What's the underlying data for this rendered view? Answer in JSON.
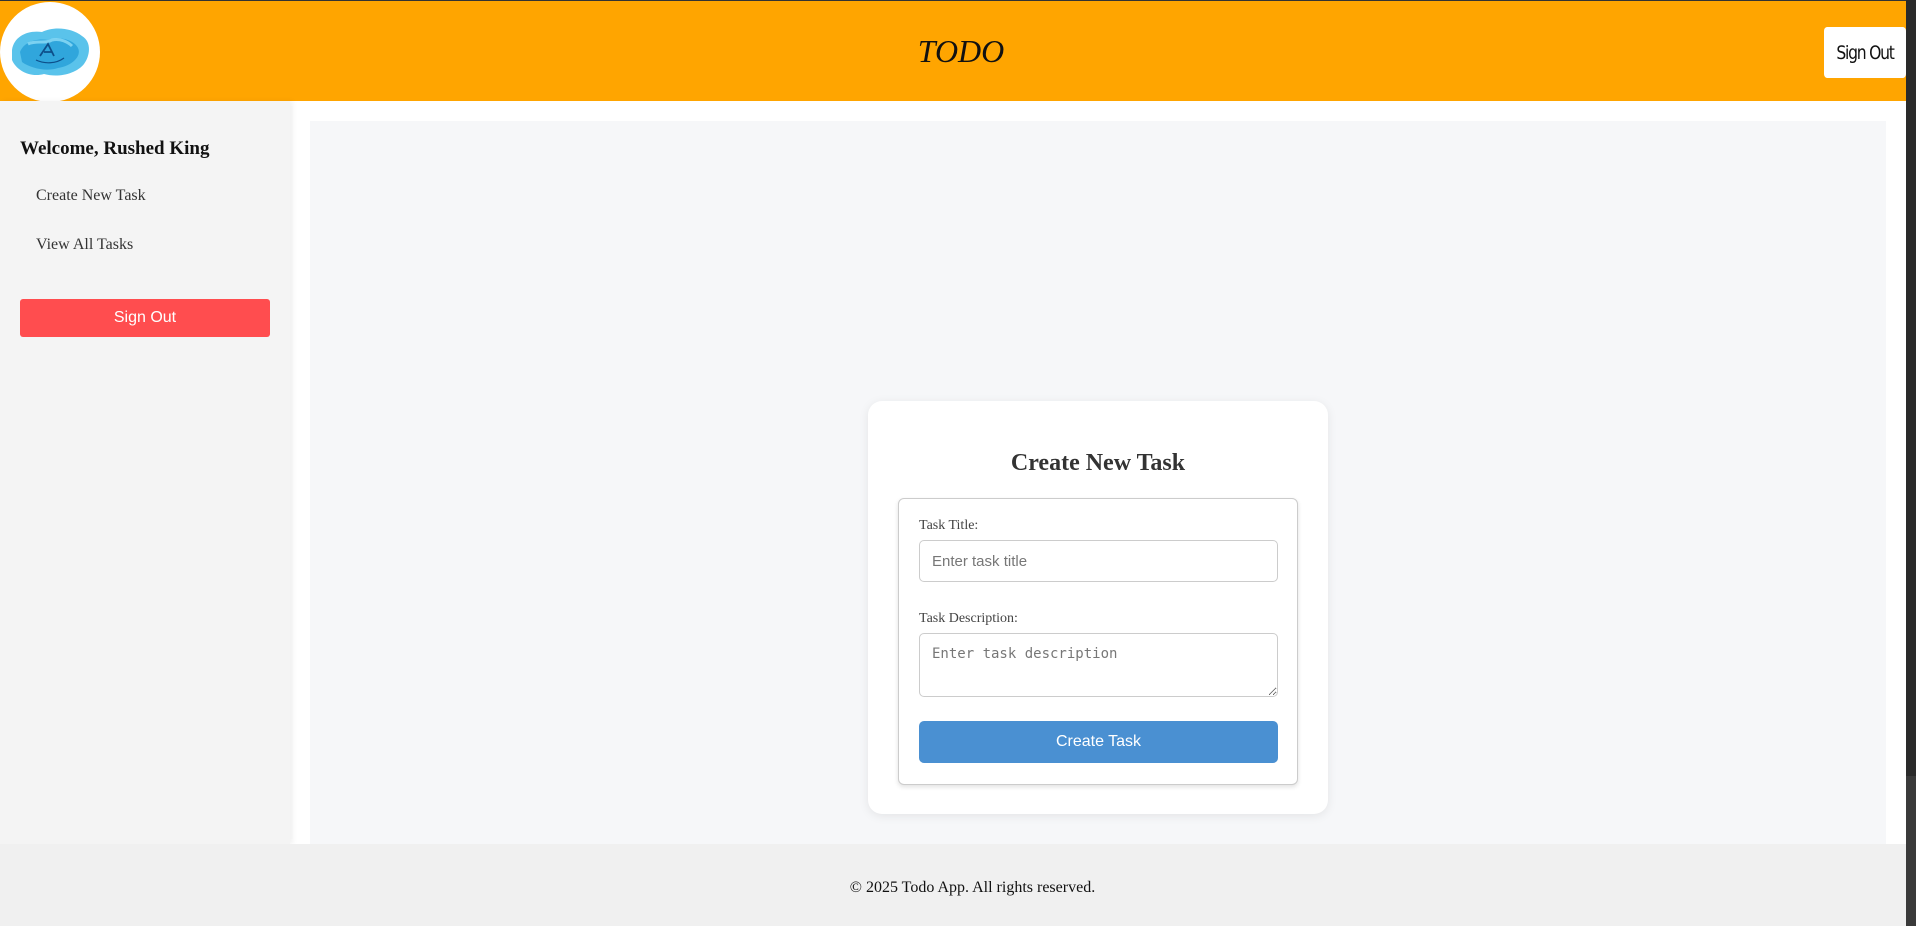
{
  "header": {
    "title": "TODO",
    "signout_label": "Sign Out",
    "logo_icon": "watercolor-logo-icon"
  },
  "sidebar": {
    "welcome": "Welcome, Rushed King",
    "items": [
      {
        "label": "Create New Task"
      },
      {
        "label": "View All Tasks"
      }
    ],
    "signout_label": "Sign Out"
  },
  "form": {
    "heading": "Create New Task",
    "title_label": "Task Title:",
    "title_placeholder": "Enter task title",
    "title_value": "",
    "description_label": "Task Description:",
    "description_placeholder": "Enter task description",
    "description_value": "",
    "submit_label": "Create Task"
  },
  "footer": {
    "text": "© 2025 Todo App. All rights reserved."
  },
  "colors": {
    "header_bg": "#ffa500",
    "sidebar_signout": "#ff4d4f",
    "primary_button": "#4a90d2"
  }
}
